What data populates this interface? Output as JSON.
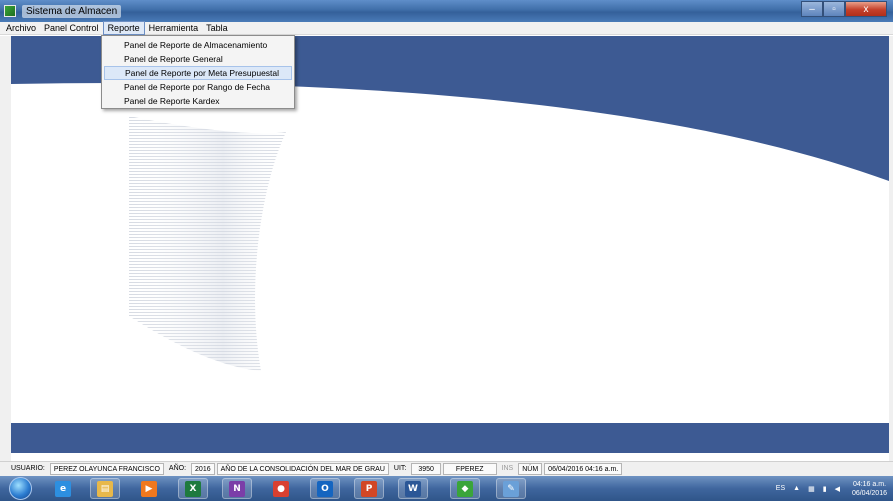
{
  "window": {
    "title": "Sistema de Almacen",
    "buttons": [
      "–",
      "▫",
      "x"
    ]
  },
  "menubar": {
    "items": [
      "Archivo",
      "Panel Control",
      "Reporte",
      "Herramienta",
      "Tabla"
    ],
    "active": "Reporte"
  },
  "reporte_menu": {
    "items": [
      "Panel de Reporte de Almacenamiento",
      "Panel de Reporte General",
      "Panel de Reporte por Meta Presupuestal",
      "Panel de Reporte por Rango de Fecha",
      "Panel de Reporte Kardex"
    ],
    "highlighted": "Panel de Reporte por Meta Presupuestal"
  },
  "statusbar": {
    "usuario_label": "USUARIO:",
    "usuario": "PEREZ OLAYUNCA FRANCISCO",
    "anio_label": "AÑO:",
    "anio": "2016",
    "anio_nombre": "AÑO DE LA CONSOLIDACIÓN DEL MAR DE GRAU",
    "uit_label": "UIT:",
    "uit": "3950",
    "login": "FPEREZ",
    "ins": "INS",
    "num": "NÚM",
    "datetime": "06/04/2016 04:16 a.m."
  },
  "taskbar": {
    "apps": [
      {
        "name": "internet-explorer",
        "glyph": "e",
        "color": "#2d8fe0"
      },
      {
        "name": "file-explorer",
        "glyph": "▤",
        "color": "#e8b84a"
      },
      {
        "name": "media-player",
        "glyph": "▶",
        "color": "#f0781e"
      },
      {
        "name": "excel",
        "glyph": "X",
        "color": "#1e7a3e"
      },
      {
        "name": "onenote",
        "glyph": "N",
        "color": "#7b3ea8"
      },
      {
        "name": "chrome",
        "glyph": "●",
        "color": "#d94030"
      },
      {
        "name": "outlook",
        "glyph": "O",
        "color": "#1565c0"
      },
      {
        "name": "powerpoint",
        "glyph": "P",
        "color": "#d24726"
      },
      {
        "name": "word",
        "glyph": "W",
        "color": "#2b5797"
      },
      {
        "name": "sistema-almacen",
        "glyph": "◆",
        "color": "#3aa53a"
      },
      {
        "name": "paint",
        "glyph": "✎",
        "color": "#6aa0d8"
      }
    ],
    "tray": {
      "lang": "ES",
      "time": "04:16 a.m.",
      "date": "06/04/2016"
    }
  },
  "colors": {
    "band": "#3d5a93",
    "titlebar": "#4a7bb8"
  }
}
